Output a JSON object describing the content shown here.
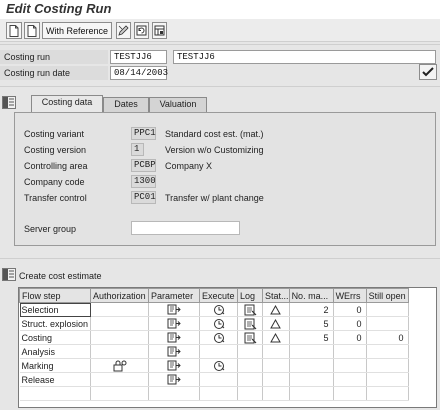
{
  "window": {
    "title": "Edit Costing Run"
  },
  "toolbar": {
    "with_reference_label": "With Reference",
    "icons": [
      "new-document-icon",
      "copy-document-icon",
      "with-reference-button",
      "edit-pencil-icon",
      "refresh-icon",
      "settings-table-icon"
    ]
  },
  "header": {
    "costing_run_label": "Costing run",
    "costing_run_value": "TESTJJ6",
    "costing_run_desc": "TESTJJ6",
    "costing_run_date_label": "Costing run date",
    "costing_run_date_value": "08/14/2003"
  },
  "tabs": [
    {
      "label": "Costing data",
      "active": true
    },
    {
      "label": "Dates",
      "active": false
    },
    {
      "label": "Valuation",
      "active": false
    }
  ],
  "costing_data": {
    "rows": [
      {
        "label": "Costing variant",
        "code": "PPC1",
        "desc": "Standard cost est. (mat.)"
      },
      {
        "label": "Costing version",
        "code": "1",
        "desc": "Version w/o Customizing"
      },
      {
        "label": "Controlling area",
        "code": "PCBP",
        "desc": "Company X"
      },
      {
        "label": "Company code",
        "code": "1300",
        "desc": ""
      },
      {
        "label": "Transfer control",
        "code": "PC01",
        "desc": "Transfer w/ plant change"
      }
    ],
    "server_group_label": "Server group",
    "server_group_value": ""
  },
  "cost_estimate": {
    "title": "Create cost estimate",
    "columns": [
      "Flow step",
      "Authorization",
      "Parameter",
      "Execute",
      "Log",
      "Stat...",
      "No. ma...",
      "WErrs",
      "Still open"
    ],
    "rows": [
      {
        "step": "Selection",
        "auth": false,
        "param": true,
        "exec": true,
        "log": true,
        "status": true,
        "no_ma": "2",
        "werrs": "0",
        "still_open": ""
      },
      {
        "step": "Struct. explosion",
        "auth": false,
        "param": true,
        "exec": true,
        "log": true,
        "status": true,
        "no_ma": "5",
        "werrs": "0",
        "still_open": ""
      },
      {
        "step": "Costing",
        "auth": false,
        "param": true,
        "exec": true,
        "log": true,
        "status": true,
        "no_ma": "5",
        "werrs": "0",
        "still_open": "0"
      },
      {
        "step": "Analysis",
        "auth": false,
        "param": true,
        "exec": false,
        "log": false,
        "status": false,
        "no_ma": "",
        "werrs": "",
        "still_open": ""
      },
      {
        "step": "Marking",
        "auth": true,
        "param": true,
        "exec": true,
        "log": false,
        "status": false,
        "no_ma": "",
        "werrs": "",
        "still_open": ""
      },
      {
        "step": "Release",
        "auth": false,
        "param": true,
        "exec": false,
        "log": false,
        "status": false,
        "no_ma": "",
        "werrs": "",
        "still_open": ""
      }
    ]
  }
}
